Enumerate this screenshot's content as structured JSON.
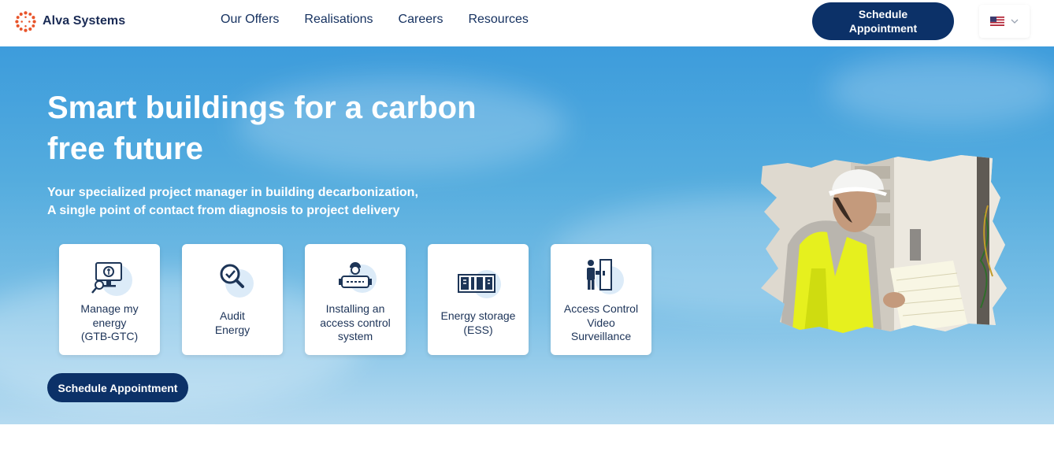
{
  "header": {
    "brand": "Alva Systems",
    "nav": [
      "Our Offers",
      "Realisations",
      "Careers",
      "Resources"
    ],
    "cta_lines": [
      "Schedule",
      "Appointment"
    ],
    "language_flag": "us-flag-icon"
  },
  "hero": {
    "title_lines": [
      "Smart buildings for a carbon",
      "free future"
    ],
    "subtitle_lines": [
      "Your specialized project manager in building decarbonization,",
      "A single point of contact from diagnosis to project delivery"
    ],
    "cards": [
      {
        "icon": "energy-monitor-icon",
        "lines": [
          "Manage my",
          "energy",
          "(GTB-GTC)"
        ]
      },
      {
        "icon": "audit-magnifier-icon",
        "lines": [
          "Audit",
          "Energy"
        ]
      },
      {
        "icon": "technician-access-icon",
        "lines": [
          "Installing an",
          "access control",
          "system"
        ]
      },
      {
        "icon": "battery-storage-icon",
        "lines": [
          "Energy storage",
          "(ESS)"
        ]
      },
      {
        "icon": "access-door-person-icon",
        "lines": [
          "Access Control",
          "Video",
          "Surveillance"
        ]
      }
    ],
    "cta": "Schedule Appointment",
    "colors": {
      "primary": "#0c3168",
      "accent": "#e8542a",
      "sky_top": "#3d9cdc",
      "sky_bottom": "#b5daf0",
      "icon_bg": "#dcebf8"
    }
  }
}
